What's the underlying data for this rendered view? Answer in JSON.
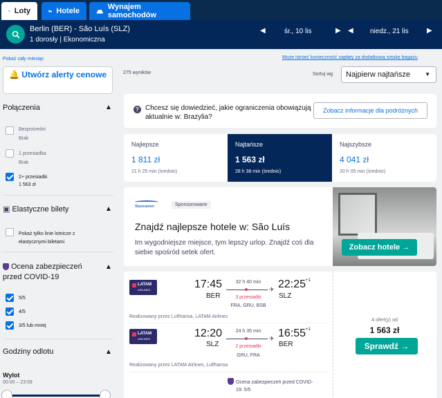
{
  "tabs": [
    {
      "label": "Loty",
      "icon": "plane-icon"
    },
    {
      "label": "Hotele",
      "icon": "bed-icon"
    },
    {
      "label": "Wynajem samochodów",
      "icon": "car-icon"
    }
  ],
  "search": {
    "route": "Berlin (BER) - São Luís (SLZ)",
    "passengers": "1 dorosły",
    "cabin": "Ekonomiczna",
    "depart_date": "śr., 10 lis",
    "return_date": "niedz., 21 lis"
  },
  "links": {
    "show_month": "Pokaż cały miesiąc",
    "baggage_note": "Może istnieć konieczność zapłaty za dodatkową sztukę bagażu"
  },
  "sidebar": {
    "alert_button": "Utwórz alerty cenowe",
    "connections": {
      "title": "Połączenia",
      "options": [
        {
          "label": "Bezpośredni",
          "sub": "Brak",
          "checked": false
        },
        {
          "label": "1 przesiadka",
          "sub": "Brak",
          "checked": false
        },
        {
          "label": "2+ przesiadki",
          "sub": "1 563 zł",
          "checked": true
        }
      ]
    },
    "flexible": {
      "title": "Elastyczne bilety",
      "option": "Pokaż tylko linie lotnicze z elastycznymi biletami",
      "checked": false
    },
    "covid": {
      "title": "Ocena zabezpieczeń przed COVID-19",
      "options": [
        {
          "label": "5/5",
          "checked": true
        },
        {
          "label": "4/5",
          "checked": true
        },
        {
          "label": "3/5 lub mniej",
          "checked": true
        }
      ]
    },
    "departure_times": {
      "title": "Godziny odlotu",
      "subtitle": "Wylot",
      "range": "00:00 – 23:59"
    }
  },
  "results": {
    "count": "275 wyników",
    "sort_label": "Sortuj wg",
    "sort_value": "Najpierw najtańsze"
  },
  "info": {
    "text": "Chcesz się dowiedzieć, jakie ograniczenia obowiązują aktualnie w: Brazylia?",
    "button": "Zobacz informacje dla podróżnych"
  },
  "price_tabs": [
    {
      "title": "Najlepsze",
      "price": "1 811 zł",
      "duration": "21 h 25 min (średnio)",
      "selected": false
    },
    {
      "title": "Najtańsze",
      "price": "1 563 zł",
      "duration": "28 h 38 min (średnio)",
      "selected": true
    },
    {
      "title": "Najszybsze",
      "price": "4 041 zł",
      "duration": "20 h 05 min (średnio)",
      "selected": false
    }
  ],
  "ad": {
    "logo": "Skyscanner",
    "badge": "Sponsorowane",
    "title": "Znajdź najlepsze hotele w: São Luís",
    "text": "Im wygodniejsze miejsce, tym lepszy urlop. Znajdź coś dla siebie spośród setek ofert.",
    "button": "Zobacz hotele →"
  },
  "flight": {
    "legs": [
      {
        "airline": "LATAM",
        "airline_sub": "AIRLINES",
        "dep_time": "17:45",
        "dep_code": "BER",
        "duration": "32 h 40 min",
        "stops": "3 przesiadki",
        "via": "FRA, GRU, BSB",
        "arr_time": "22:25",
        "arr_offset": "+1",
        "arr_code": "SLZ",
        "operated": "Realizowany przez Lufthansa, LATAM Airlines"
      },
      {
        "airline": "LATAM",
        "airline_sub": "AIRLINES",
        "dep_time": "12:20",
        "dep_code": "SLZ",
        "duration": "24 h 35 min",
        "stops": "2 przesiadki",
        "via": "GRU, FRA",
        "arr_time": "16:55",
        "arr_offset": "+1",
        "arr_code": "BER",
        "operated": "Realizowany przez LATAM Airlines, Lufthansa"
      }
    ],
    "offers": "4 ofert(y) od",
    "price": "1 563 zł",
    "button": "Sprawdź →",
    "covid_rating_line1": "Ocena zabezpieczeń przed COVID-",
    "covid_rating_line2": "19: 5/5"
  },
  "colors": {
    "brand_dark": "#042759",
    "brand_blue": "#0770e3",
    "teal": "#00a698"
  }
}
